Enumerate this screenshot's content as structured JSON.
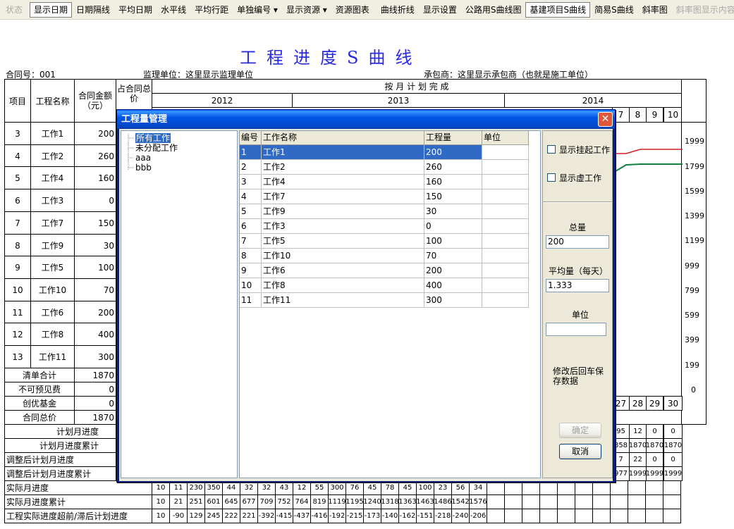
{
  "toolbar": {
    "items": [
      "状态",
      "显示日期",
      "日期隔线",
      "平均日期",
      "水平线",
      "平均行距",
      "单独编号 ▾",
      "显示资源 ▾",
      "资源图表",
      "曲线折线",
      "显示设置",
      "公路用S曲线图",
      "基建项目S曲线",
      "简易S曲线",
      "斜率图",
      "斜率图显示内容 ▾"
    ],
    "pressed": [
      "显示日期",
      "基建项目S曲线"
    ],
    "disabled": [
      "状态",
      "斜率图显示内容 ▾"
    ]
  },
  "report": {
    "title": "工程进度S曲线",
    "contract": "合同号：001",
    "supervisor": "监理单位：这里显示监理单位",
    "contractor": "承包商：这里显示承包商（也就是施工单位）",
    "headers": {
      "item": "项目",
      "name": "工程名称",
      "amount": "合同金额（元）",
      "share": "占合同总价",
      "plan": "按 月 计 划 完 成"
    },
    "years": [
      "2012",
      "2013",
      "2014"
    ],
    "month_headers_right": [
      "7",
      "8",
      "9",
      "10"
    ],
    "rows": [
      {
        "no": "3",
        "name": "工作1",
        "amount": "200"
      },
      {
        "no": "4",
        "name": "工作2",
        "amount": "260"
      },
      {
        "no": "5",
        "name": "工作4",
        "amount": "160"
      },
      {
        "no": "6",
        "name": "工作3",
        "amount": "0"
      },
      {
        "no": "7",
        "name": "工作7",
        "amount": "150"
      },
      {
        "no": "8",
        "name": "工作9",
        "amount": "30"
      },
      {
        "no": "9",
        "name": "工作5",
        "amount": "100"
      },
      {
        "no": "10",
        "name": "工作10",
        "amount": "70"
      },
      {
        "no": "11",
        "name": "工作6",
        "amount": "200"
      },
      {
        "no": "12",
        "name": "工作8",
        "amount": "400"
      },
      {
        "no": "13",
        "name": "工作11",
        "amount": "300"
      }
    ],
    "summary": [
      {
        "label": "清单合计",
        "value": "1870"
      },
      {
        "label": "不可预见费",
        "value": "0"
      },
      {
        "label": "创优基金",
        "value": "0"
      },
      {
        "label": "合同总价",
        "value": "1870"
      }
    ],
    "right_axis": [
      "1999",
      "1799",
      "1599",
      "1399",
      "1199",
      "999",
      "799",
      "599",
      "399",
      "199",
      "0"
    ],
    "day_row": [
      "27",
      "28",
      "29",
      "30"
    ],
    "bottom_rows": [
      {
        "label": "计划月进度",
        "right": [
          "95",
          "12",
          "0",
          "0"
        ]
      },
      {
        "label": "计划月进度累计",
        "right": [
          "858",
          "1870",
          "1870",
          "1870"
        ]
      },
      {
        "label": "调整后计划月进度",
        "right": [
          "7",
          "22",
          "0",
          "0"
        ]
      },
      {
        "label": "调整后计划月进度累计",
        "right": [
          "977",
          "1999",
          "1999",
          "1999"
        ]
      }
    ],
    "actual_rows": [
      {
        "label": "实际月进度",
        "values": [
          "10",
          "11",
          "230",
          "350",
          "44",
          "32",
          "32",
          "43",
          "12",
          "55",
          "300",
          "76",
          "45",
          "78",
          "45",
          "100",
          "23",
          "56",
          "34"
        ]
      },
      {
        "label": "实际月进度累计",
        "values": [
          "10",
          "21",
          "251",
          "601",
          "645",
          "677",
          "709",
          "752",
          "764",
          "819",
          "1119",
          "1195",
          "1240",
          "1318",
          "1363",
          "1463",
          "1486",
          "1542",
          "1576"
        ]
      },
      {
        "label": "工程实际进度超前/滞后计划进度",
        "values": [
          "10",
          "-90",
          "129",
          "245",
          "222",
          "221",
          "-392",
          "-415",
          "-437",
          "-416",
          "-192",
          "-215",
          "-173",
          "-140",
          "-162",
          "-151",
          "-218",
          "-240",
          "-206"
        ]
      }
    ]
  },
  "dialog": {
    "title": "工程量管理",
    "close": "✕",
    "tree": [
      {
        "label": "所有工作",
        "selected": true
      },
      {
        "label": "未分配工作",
        "selected": false
      },
      {
        "label": "aaa",
        "selected": false
      },
      {
        "label": "bbb",
        "selected": false
      }
    ],
    "columns": [
      "编号",
      "工作名称",
      "工程量",
      "单位"
    ],
    "rows": [
      [
        "1",
        "工作1",
        "200",
        ""
      ],
      [
        "2",
        "工作2",
        "260",
        ""
      ],
      [
        "3",
        "工作4",
        "160",
        ""
      ],
      [
        "4",
        "工作7",
        "150",
        ""
      ],
      [
        "5",
        "工作9",
        "30",
        ""
      ],
      [
        "6",
        "工作3",
        "0",
        ""
      ],
      [
        "7",
        "工作5",
        "100",
        ""
      ],
      [
        "8",
        "工作10",
        "70",
        ""
      ],
      [
        "9",
        "工作6",
        "200",
        ""
      ],
      [
        "10",
        "工作8",
        "400",
        ""
      ],
      [
        "11",
        "工作11",
        "300",
        ""
      ]
    ],
    "show_hang": "显示挂起工作",
    "show_virtual": "显示虚工作",
    "total_label": "总量",
    "total_value": "200",
    "avg_label": "平均量（每天）",
    "avg_value": "1.333",
    "unit_label": "单位",
    "unit_value": "",
    "note": "修改后回车保存数据",
    "ok": "确定",
    "cancel": "取消"
  }
}
